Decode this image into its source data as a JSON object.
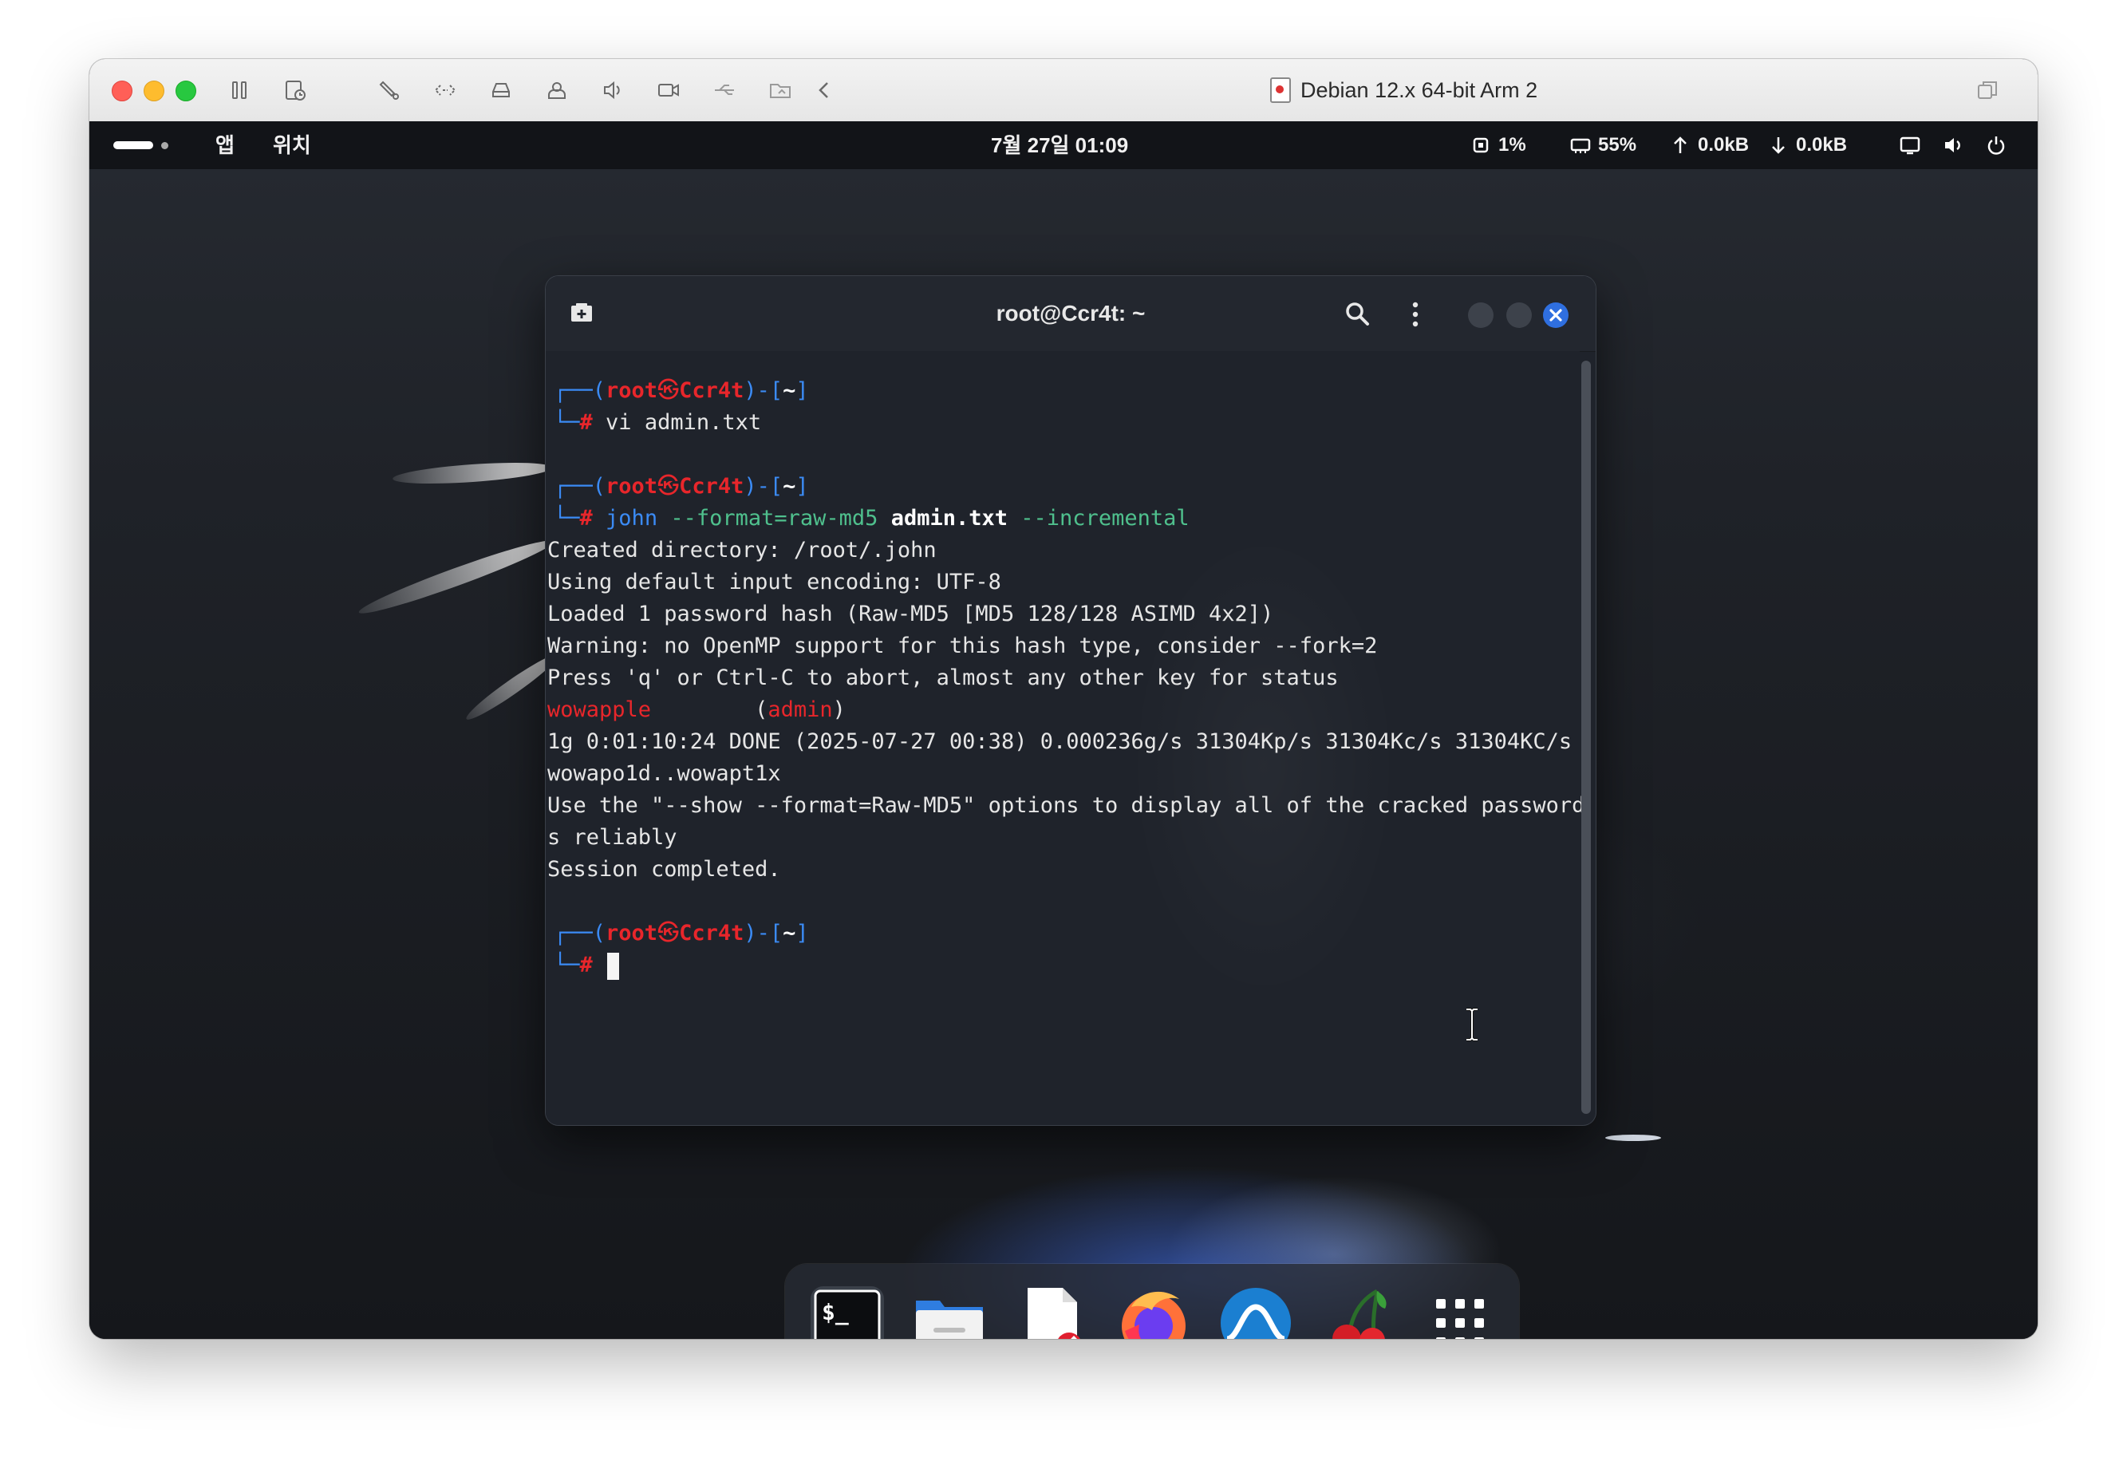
{
  "vm": {
    "title": "Debian 12.x 64-bit Arm 2"
  },
  "topbar": {
    "apps_label": "앱",
    "places_label": "위치",
    "datetime": "7월 27일 01:09",
    "cpu": "1%",
    "memory": "55%",
    "upload": "0.0kB",
    "download": "0.0kB"
  },
  "terminal": {
    "title": "root@Ccr4t: ~",
    "prompt": {
      "corner_top": "┌──(",
      "user": "root",
      "skull": "㉿",
      "host": "Ccr4t",
      "close_paren": ")-[",
      "path": "~",
      "close_bracket": "]",
      "corner_bottom": "└─",
      "hash": "#"
    },
    "cmd1": "vi admin.txt",
    "cmd2": {
      "program": "john",
      "opt1": "--format=raw-md5",
      "file": "admin.txt",
      "opt2": "--incremental"
    },
    "output": [
      "Created directory: /root/.john",
      "Using default input encoding: UTF-8",
      "Loaded 1 password hash (Raw-MD5 [MD5 128/128 ASIMD 4x2])",
      "Warning: no OpenMP support for this hash type, consider --fork=2",
      "Press 'q' or Ctrl-C to abort, almost any other key for status"
    ],
    "cracked": {
      "password": "wowapple",
      "spacing": "        (",
      "user": "admin",
      "close": ")"
    },
    "output2": [
      "1g 0:01:10:24 DONE (2025-07-27 00:38) 0.000236g/s 31304Kp/s 31304Kc/s 31304KC/s",
      "wowapo1d..wowapt1x",
      "Use the \"--show --format=Raw-MD5\" options to display all of the cracked password",
      "s reliably",
      "Session completed."
    ]
  },
  "dock": {
    "items": [
      "terminal-app",
      "files-app",
      "text-editor-app",
      "firefox-app",
      "wireshark-app",
      "cherrytree-app",
      "show-apps-grid"
    ]
  },
  "colors": {
    "prompt_blue": "#3b8bf5",
    "prompt_red": "#e8262b",
    "option_green": "#4fc08d",
    "close_button_blue": "#2f6fe0"
  }
}
